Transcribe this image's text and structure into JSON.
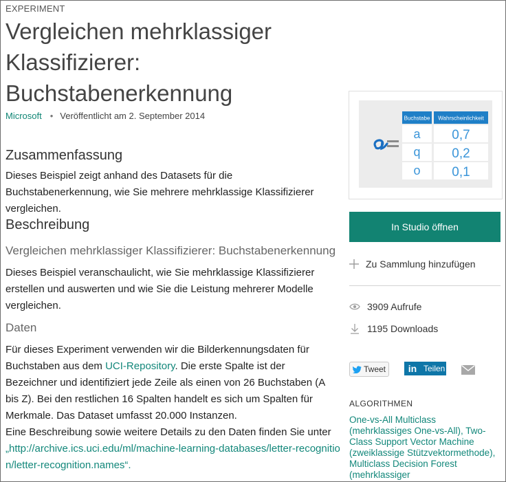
{
  "header": {
    "category": "EXPERIMENT",
    "title": "Vergleichen mehrklassiger Klassifizierer: Buchstabenerkennung",
    "publisher": "Microsoft",
    "separator": "•",
    "published": "Veröffentlicht am 2. September 2014"
  },
  "summary": {
    "heading": "Zusammenfassung",
    "text": "Dieses Beispiel zeigt anhand des Datasets für die Buchstabenerkennung, wie Sie mehrere mehrklassige Klassifizierer vergleichen."
  },
  "description": {
    "heading": "Beschreibung",
    "subheading": "Vergleichen mehrklassiger Klassifizierer: Buchstabenerkennung",
    "intro": "Dieses Beispiel veranschaulicht, wie Sie mehrklassige Klassifizierer erstellen und auswerten und wie Sie die Leistung mehrerer Modelle vergleichen.",
    "data_heading": "Daten",
    "data_text_1": "Für dieses Experiment verwenden wir die Bilderkennungsdaten für Buchstaben aus dem ",
    "data_link": "UCI-Repository",
    "data_text_2": ". Die erste Spalte ist der Bezeichner und identifiziert jede Zeile als einen von 26 Buchstaben (A bis Z). Bei den restlichen 16 Spalten handelt es sich um Spalten für Merkmale. Das Dataset umfasst 20.000 Instanzen.",
    "more_info": "Eine Beschreibung sowie weitere Details zu den Daten finden Sie unter",
    "url_text": "„http://archive.ics.uci.edu/ml/machine-learning-databases/letter-recognition/letter-recognition.names“."
  },
  "thumbnail": {
    "col_letter": "Buchstabe",
    "col_prob": "Wahrscheinlichkeit",
    "rows": [
      {
        "letter": "a",
        "prob": "0,7"
      },
      {
        "letter": "q",
        "prob": "0,2"
      },
      {
        "letter": "o",
        "prob": "0,1"
      }
    ],
    "handwritten_icon": "handwritten-a-icon"
  },
  "sidebar": {
    "open_label": "In Studio öffnen",
    "collection_label": "Zu Sammlung hinzufügen",
    "views": "3909 Aufrufe",
    "downloads": "1195 Downloads",
    "tweet_label": "Tweet",
    "share_label": "Teilen",
    "algorithms_heading": "ALGORITHMEN",
    "algorithms_text": "One-vs-All Multiclass (mehrklassiges One-vs-All), Two-Class Support Vector Machine (zweiklassige Stützvektormethode), Multiclass Decision Forest (mehrklassiger"
  },
  "colors": {
    "accent": "#128372",
    "link": "#12877a",
    "table_header": "#1f7fc7",
    "linkedin": "#0e76a8"
  }
}
